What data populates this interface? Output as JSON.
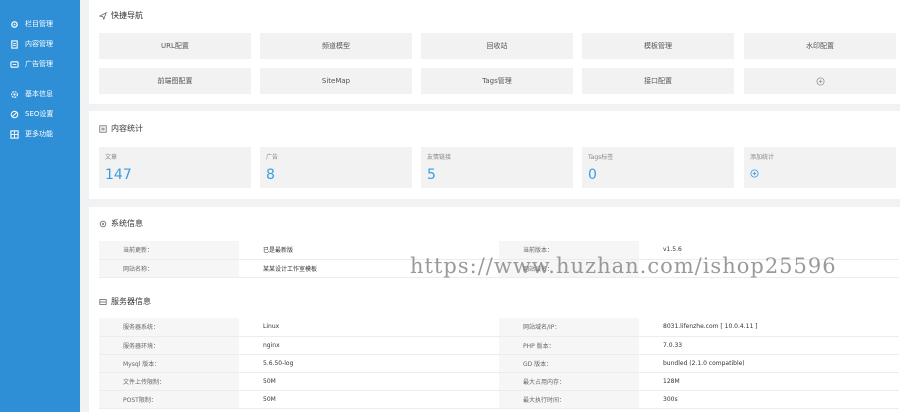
{
  "sidebar": {
    "items": [
      {
        "label": "栏目管理",
        "icon": "gear-icon"
      },
      {
        "label": "内容管理",
        "icon": "document-icon"
      },
      {
        "label": "广告管理",
        "icon": "ad-icon"
      },
      {
        "label": "基本信息",
        "icon": "settings-icon"
      },
      {
        "label": "SEO设置",
        "icon": "seo-icon"
      },
      {
        "label": "更多功能",
        "icon": "grid-icon"
      }
    ]
  },
  "quicknav": {
    "title": "快捷导航",
    "buttons": [
      "URL配置",
      "频道模型",
      "回收站",
      "模板管理",
      "水印配置",
      "前端图配置",
      "SiteMap",
      "Tags管理",
      "接口配置"
    ]
  },
  "stats": {
    "title": "内容统计",
    "items": [
      {
        "label": "文章",
        "value": "147"
      },
      {
        "label": "广告",
        "value": "8"
      },
      {
        "label": "友情链接",
        "value": "5"
      },
      {
        "label": "Tags标签",
        "value": "0"
      },
      {
        "label": "添加统计"
      }
    ]
  },
  "sysinfo": {
    "title": "系统信息",
    "rows": [
      [
        "当前更新：",
        "已是最新版",
        "当前版本：",
        "v1.5.6"
      ],
      [
        "网站名称：",
        "某某设计工作室模板",
        "网站域名：",
        ""
      ]
    ]
  },
  "server": {
    "title": "服务器信息",
    "rows": [
      [
        "服务器系统：",
        "Linux",
        "网站域名/IP：",
        "8031.lifenzhe.com [ 10.0.4.11 ]"
      ],
      [
        "服务器环境：",
        "nginx",
        "PHP 版本：",
        "7.0.33"
      ],
      [
        "Mysql 版本：",
        "5.6.50-log",
        "GD 版本：",
        "bundled (2.1.0 compatible)"
      ],
      [
        "文件上传限制：",
        "50M",
        "最大占用内存：",
        "128M"
      ],
      [
        "POST限制：",
        "50M",
        "最大执行时间：",
        "300s"
      ]
    ]
  },
  "watermark": "https://www.huzhan.com/ishop25596",
  "colors": {
    "sidebar": "#2f8fd6",
    "accent": "#3a9de2",
    "panel": "#ffffff",
    "tile": "#f2f2f2"
  }
}
